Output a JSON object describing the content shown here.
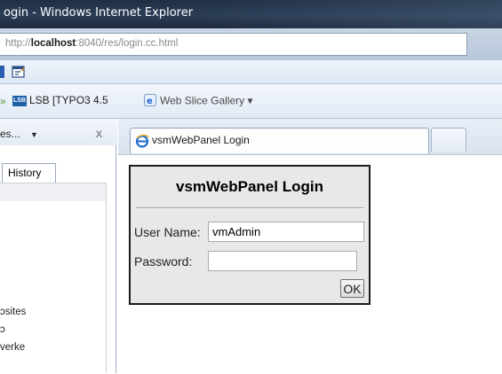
{
  "window": {
    "title": "ogin - Windows Internet Explorer",
    "address_prefix": "http://",
    "address_host": "localhost",
    "address_rest": ":8040/res/login.cc.html"
  },
  "favorites_bar": {
    "items": [
      {
        "label": "LSB [TYPO3 4.5",
        "icon": "lsb-icon"
      },
      {
        "label": "Web Slice Gallery ▾",
        "icon": "ie-icon"
      }
    ]
  },
  "side_pane": {
    "dropdown_label": "es...",
    "history_tab": "History",
    "list_items": [
      "ɔsites",
      "ɔ",
      "verke"
    ]
  },
  "tabs": [
    {
      "label": "vsmWebPanel Login",
      "active": true
    }
  ],
  "login_form": {
    "heading": "vsmWebPanel Login",
    "username_label": "User Name:",
    "username_value": "vmAdmin",
    "password_label": "Password:",
    "password_value": "",
    "ok_label": "OK"
  },
  "colors": {
    "titlebar": "#24354c",
    "chrome": "#dde7f3",
    "form_bg": "#e8e8e8",
    "form_border": "#1c1c1c"
  }
}
